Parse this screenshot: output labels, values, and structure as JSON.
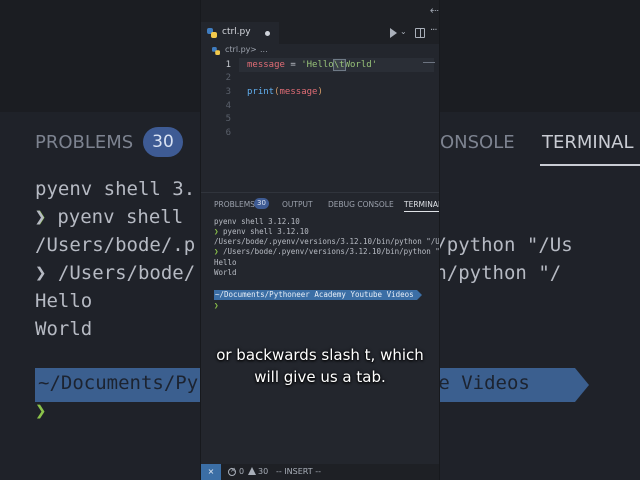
{
  "background": {
    "tabs": [
      "PROBLEMS",
      "ONSOLE",
      "TERMINAL"
    ],
    "problems_count": "30",
    "lines": [
      "pyenv shell 3.",
      "❯ pyenv shell",
      "/Users/bode/.p                0/bin/python \"/Us",
      "❯ /Users/bode/               .10/bin/python \"/",
      "Hello",
      "World"
    ],
    "path_text": "~/Documents/Py                outube Videos",
    "prompt": "❯"
  },
  "editor": {
    "tab": {
      "filename": "ctrl.py"
    },
    "breadcrumb": {
      "file": "ctrl.py",
      "separator": ">",
      "more": "..."
    },
    "line_numbers": [
      "1",
      "2",
      "3",
      "4",
      "5",
      "6"
    ],
    "code": {
      "line1": {
        "var": "message",
        "op": " = ",
        "str_open": "'Hello",
        "escape": "\\t",
        "str_rest": "World'"
      },
      "line3": {
        "fn": "print",
        "open": "(",
        "arg": "message",
        "close": ")"
      }
    }
  },
  "panel": {
    "tabs": {
      "problems": "PROBLEMS",
      "problems_count": "30",
      "output": "OUTPUT",
      "debug": "DEBUG CONSOLE",
      "terminal": "TERMINAL"
    },
    "terminal": {
      "line1": "pyenv shell 3.12.10",
      "line2_prompt": "❯",
      "line2": " pyenv shell 3.12.10",
      "line3": "/Users/bode/.pyenv/versions/3.12.10/bin/python \"/Us",
      "line4_prompt": "❯",
      "line4": " /Users/bode/.pyenv/versions/3.12.10/bin/python \"/",
      "line5": "Hello",
      "line6": "World",
      "path": "~/Documents/Pythoneer Academy Youtube Videos",
      "prompt": "❯"
    }
  },
  "statusbar": {
    "remote": "⨯",
    "errors": "0",
    "warnings": "30",
    "mode": "-- INSERT --"
  },
  "caption": {
    "line1": "or backwards slash t, which",
    "line2": "will give us a tab."
  },
  "colors": {
    "accent_blue": "#3b6ea5",
    "badge": "#3e5b94",
    "prompt_green": "#8bc34a",
    "string_green": "#98c379",
    "variable_red": "#e06c75",
    "function_blue": "#61afef"
  }
}
